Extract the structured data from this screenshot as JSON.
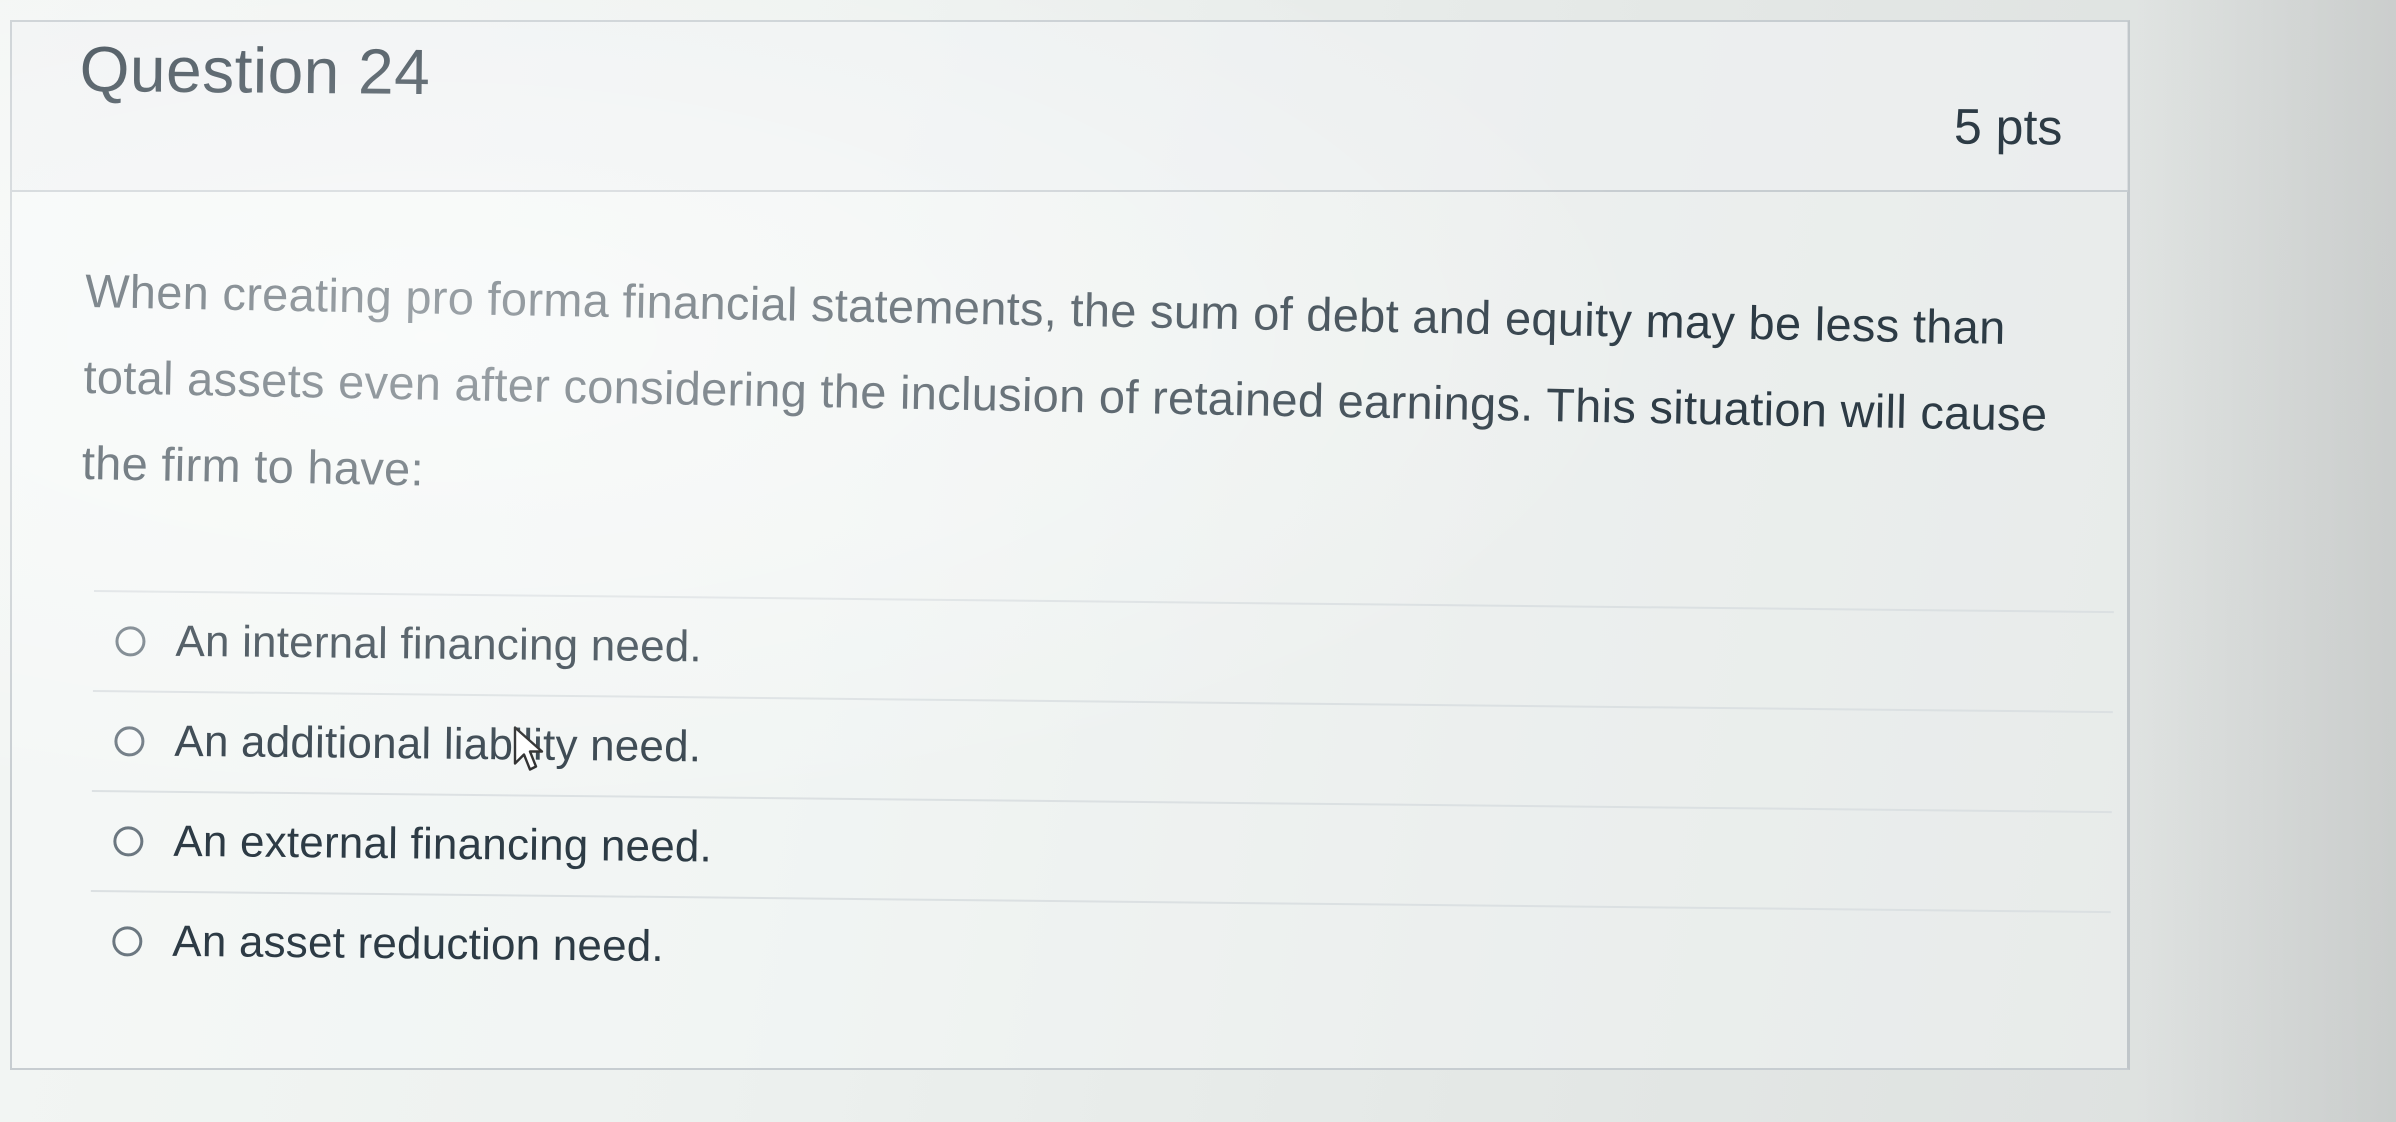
{
  "question": {
    "title": "Question 24",
    "points": "5 pts",
    "text": "When creating pro forma financial statements, the sum of debt and equity may be less than total assets even after considering the inclusion of retained earnings. This situation will cause the firm to have:"
  },
  "answers": [
    {
      "label": "An internal financing need."
    },
    {
      "label": "An additional liability need."
    },
    {
      "label": "An external financing need."
    },
    {
      "label": "An asset reduction need."
    }
  ],
  "colors": {
    "text": "#2d3b45",
    "border": "#c7cdd1",
    "radio_border": "#6b7780"
  },
  "icons": {
    "radio": "radio-button-icon",
    "cursor": "mouse-pointer-icon"
  }
}
